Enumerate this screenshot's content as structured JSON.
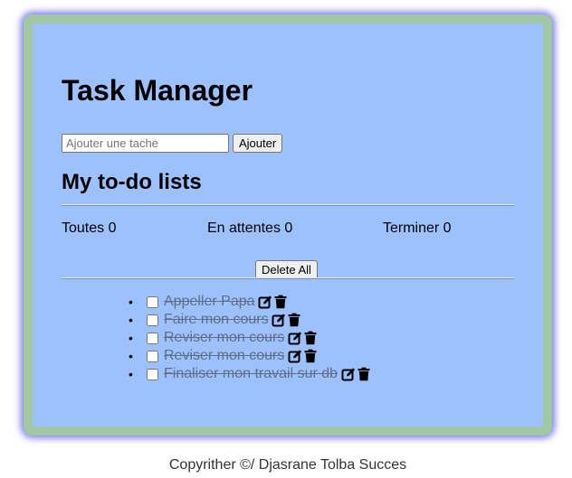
{
  "app": {
    "title": "Task Manager",
    "subtitle": "My to-do lists"
  },
  "form": {
    "placeholder": "Ajouter une tache",
    "value": "",
    "add_label": "Ajouter"
  },
  "stats": {
    "all": "Toutes 0",
    "waiting": "En attentes 0",
    "done": "Terminer 0"
  },
  "actions": {
    "delete_all_label": "Delete All"
  },
  "todos": [
    {
      "text": "Appeller Papa",
      "checked": false,
      "completed": true
    },
    {
      "text": "Faire mon cours",
      "checked": false,
      "completed": true
    },
    {
      "text": "Reviser mon cours",
      "checked": false,
      "completed": true
    },
    {
      "text": "Reviser mon cours",
      "checked": false,
      "completed": true
    },
    {
      "text": "Finaliser mon travail sur db",
      "checked": false,
      "completed": true
    }
  ],
  "icons": {
    "edit": "edit-icon",
    "delete": "trash-icon",
    "bullet": "•"
  },
  "colors": {
    "card_border": "#a1c8a2",
    "card_background": "#9cc1fd",
    "shadow": "#5050e6",
    "completed_text": "#5f6f86"
  },
  "footer": {
    "text": "Copyrither ©/ Djasrane Tolba Succes"
  }
}
